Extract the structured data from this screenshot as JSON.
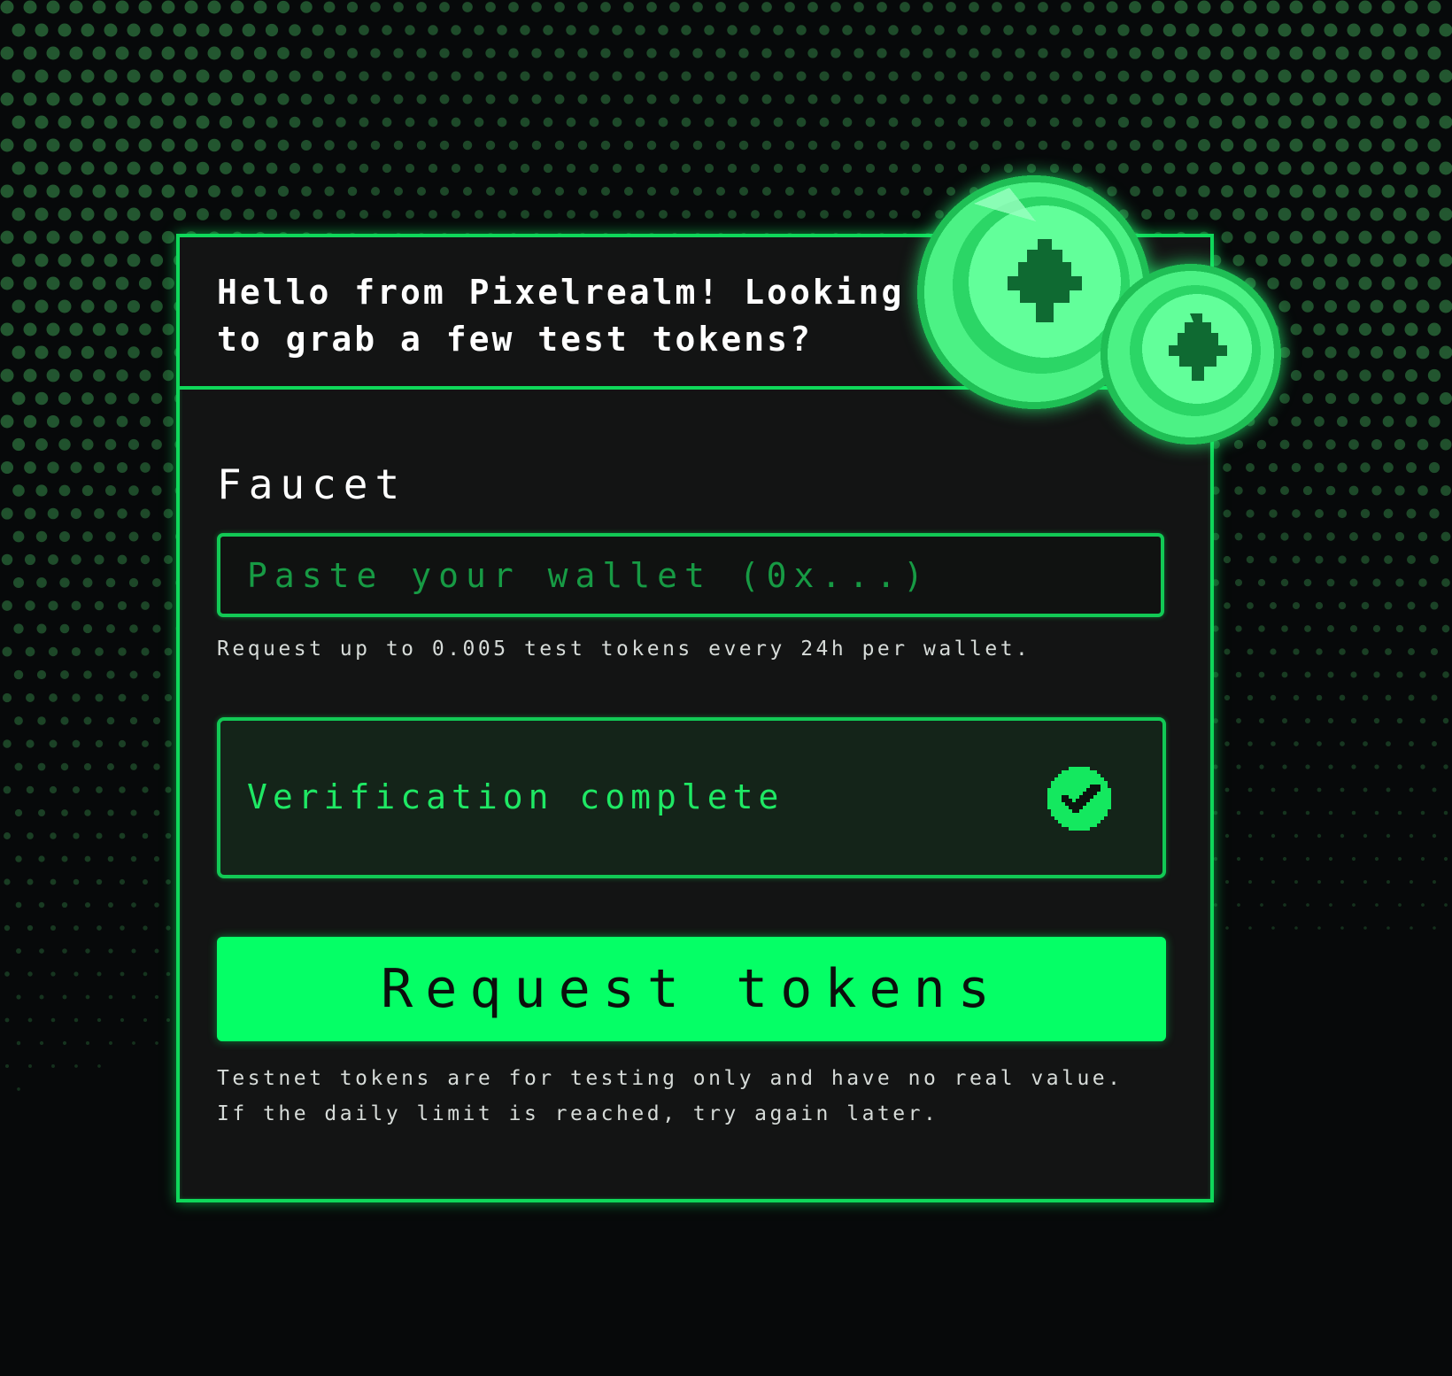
{
  "header": {
    "greeting": "Hello from Pixelrealm! Looking to grab a few test tokens?"
  },
  "faucet": {
    "title": "Faucet",
    "wallet_placeholder": "Paste your wallet (0x...)",
    "wallet_value": "",
    "hint": "Request up to 0.005 test tokens every 24h per wallet.",
    "verification_status": "Verification complete",
    "request_button_label": "Request tokens",
    "disclaimer": "Testnet tokens are for testing only and have no real value. If the daily limit is reached, try again later."
  },
  "icons": {
    "coins": "tree-coin-icon",
    "verified": "check-circle-icon"
  },
  "colors": {
    "accent": "#05ff66",
    "border": "#0fd85a",
    "card_background": "#131414",
    "page_background": "#07090a",
    "verify_background": "#142419"
  }
}
